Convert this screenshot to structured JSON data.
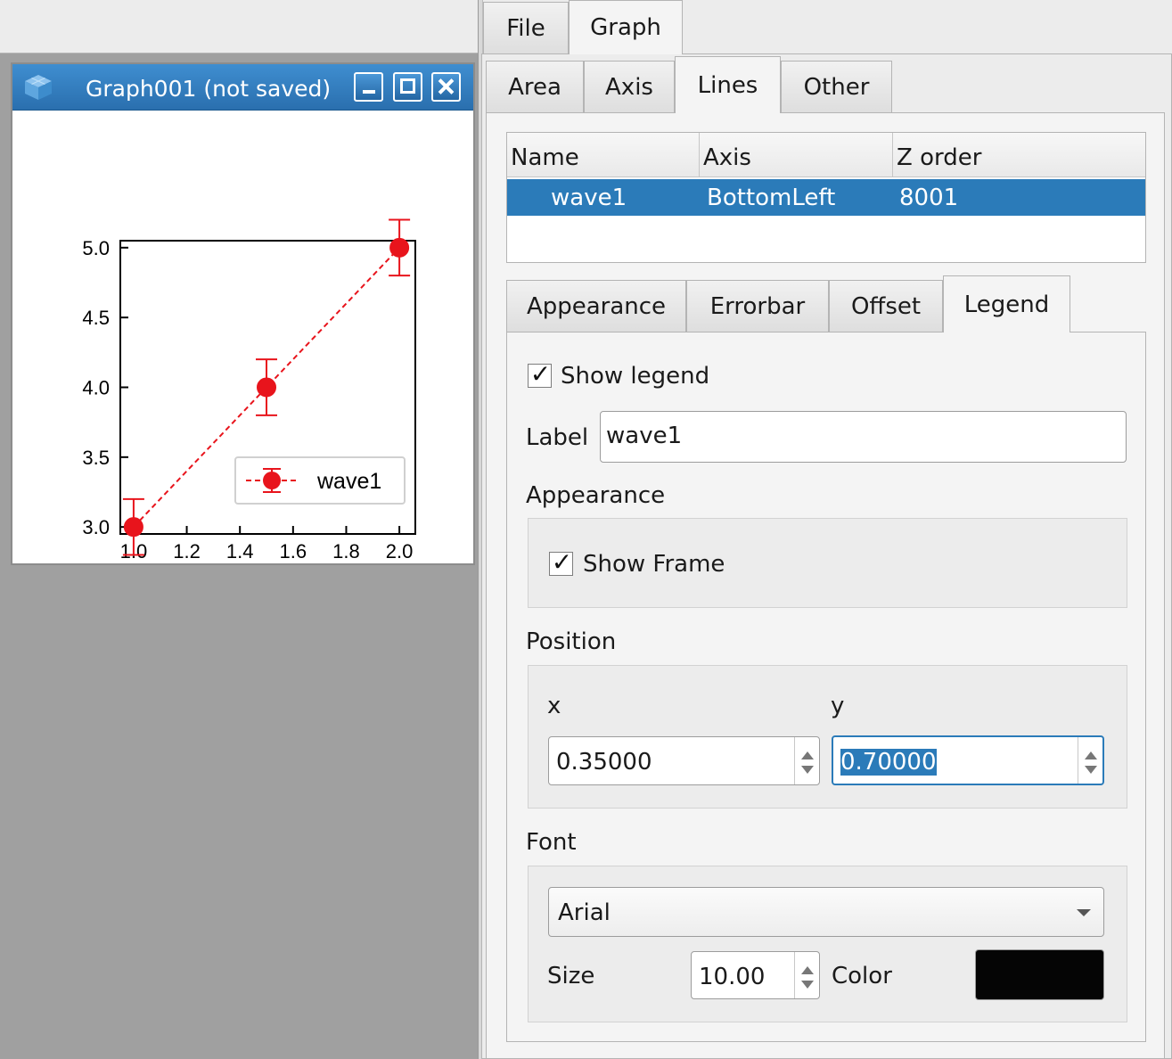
{
  "menu_tabs": [
    "File",
    "Graph"
  ],
  "graph_window": {
    "title": "Graph001 (not saved)"
  },
  "chart_data": {
    "type": "scatter",
    "x": [
      1.0,
      1.5,
      2.0
    ],
    "series": [
      {
        "name": "wave1",
        "values": [
          3.0,
          4.0,
          5.0
        ],
        "error": [
          0.2,
          0.2,
          0.2
        ],
        "color": "#e8141c",
        "line": "dashed"
      }
    ],
    "xlim": [
      0.95,
      2.06
    ],
    "ylim": [
      2.95,
      5.05
    ],
    "xticks": [
      "1.0",
      "1.2",
      "1.4",
      "1.6",
      "1.8",
      "2.0"
    ],
    "xtick_values": [
      1.0,
      1.2,
      1.4,
      1.6,
      1.8,
      2.0
    ],
    "yticks": [
      "3.0",
      "3.5",
      "4.0",
      "4.5",
      "5.0"
    ],
    "ytick_values": [
      3.0,
      3.5,
      4.0,
      4.5,
      5.0
    ],
    "legend": {
      "show": true,
      "placement": "lower-right",
      "frame": true
    }
  },
  "panel": {
    "tabs": [
      "Area",
      "Axis",
      "Lines",
      "Other"
    ],
    "active_tab": "Lines",
    "list": {
      "headers": [
        "Name",
        "Axis",
        "Z order"
      ],
      "rows": [
        {
          "name": "wave1",
          "axis": "BottomLeft",
          "z": "8001"
        }
      ]
    },
    "subtabs": [
      "Appearance",
      "Errorbar",
      "Offset",
      "Legend"
    ],
    "active_subtab": "Legend",
    "legend": {
      "show_legend_label": "Show legend",
      "show_legend": true,
      "label_caption": "Label",
      "label_value": "wave1",
      "appearance_caption": "Appearance",
      "show_frame_label": "Show Frame",
      "show_frame": true,
      "position_caption": "Position",
      "x_caption": "x",
      "x_value": "0.35000",
      "y_caption": "y",
      "y_value": "0.70000",
      "font_caption": "Font",
      "font_value": "Arial",
      "size_caption": "Size",
      "size_value": "10.00",
      "color_caption": "Color",
      "color_value": "#050505"
    }
  },
  "colors": {
    "selection": "#2b7bb9",
    "titlebar": "#2f7fc1",
    "series": "#e8141c"
  }
}
